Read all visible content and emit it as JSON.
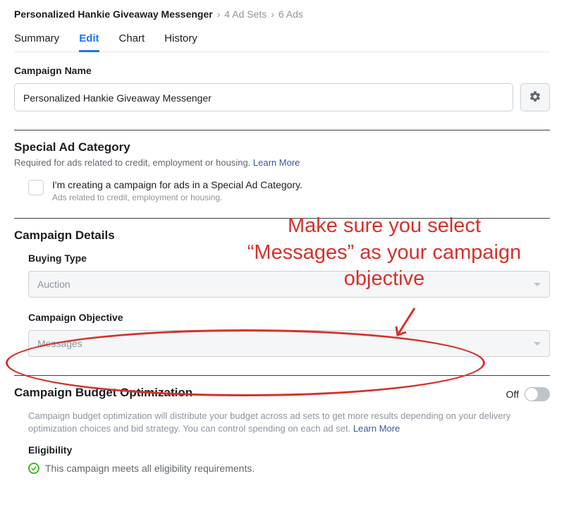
{
  "breadcrumb": {
    "current": "Personalized Hankie Giveaway Messenger",
    "ad_sets": "4 Ad Sets",
    "ads": "6 Ads"
  },
  "tabs": {
    "summary": "Summary",
    "edit": "Edit",
    "chart": "Chart",
    "history": "History"
  },
  "campaign_name": {
    "label": "Campaign Name",
    "value": "Personalized Hankie Giveaway Messenger"
  },
  "special": {
    "heading": "Special Ad Category",
    "subtext": "Required for ads related to credit, employment or housing.",
    "learn_more": "Learn More",
    "checkbox_label": "I'm creating a campaign for ads in a Special Ad Category.",
    "checkbox_sublabel": "Ads related to credit, employment or housing."
  },
  "details": {
    "heading": "Campaign Details",
    "buying_type_label": "Buying Type",
    "buying_type_value": "Auction",
    "objective_label": "Campaign Objective",
    "objective_value": "Messages"
  },
  "cbo": {
    "heading": "Campaign Budget Optimization",
    "off_label": "Off",
    "body": "Campaign budget optimization will distribute your budget across ad sets to get more results depending on your delivery optimization choices and bid strategy. You can control spending on each ad set.",
    "learn_more": "Learn More",
    "elig_label": "Eligibility",
    "elig_text": "This campaign meets all eligibility requirements."
  },
  "annotation": {
    "text": "Make sure you select “Messages” as your campaign objective"
  }
}
